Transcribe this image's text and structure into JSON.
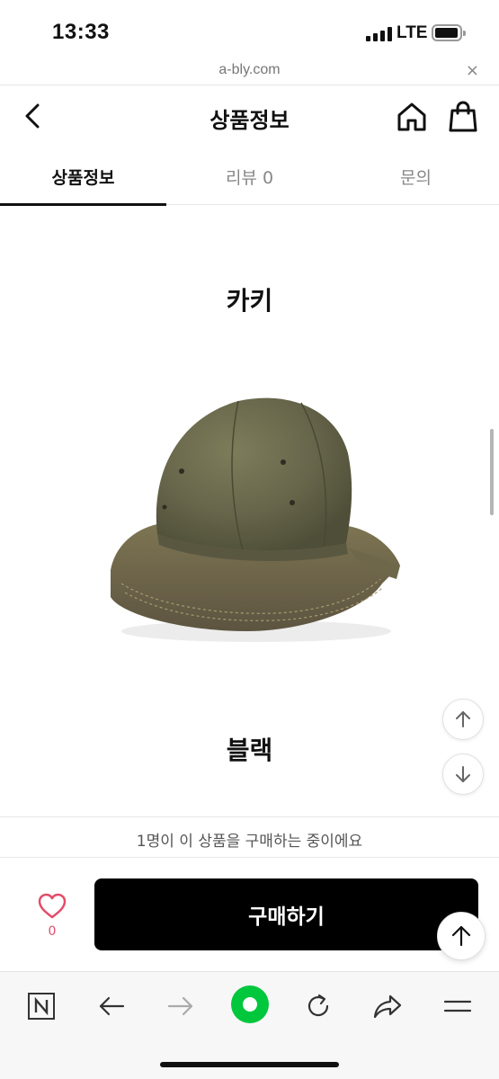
{
  "status_bar": {
    "time": "13:33",
    "network": "LTE"
  },
  "url_bar": {
    "url": "a-bly.com",
    "close_label": "×"
  },
  "header": {
    "title": "상품정보",
    "icons": [
      "back-icon",
      "home-icon",
      "bag-icon"
    ]
  },
  "tabs": [
    {
      "label": "상품정보",
      "active": true
    },
    {
      "label": "리뷰 0",
      "active": false
    },
    {
      "label": "문의",
      "active": false
    }
  ],
  "content": {
    "color_labels": [
      "카키",
      "블랙"
    ],
    "product_image": "khaki-bucket-hat"
  },
  "buy_info": {
    "text": "1명이 이 상품을 구매하는 중이에요"
  },
  "buy_bar": {
    "like_count": "0",
    "buy_label": "구매하기"
  },
  "browser_toolbar": {
    "icons": [
      "naver-icon",
      "back-arrow-icon",
      "forward-arrow-icon",
      "green-dot-icon",
      "reload-icon",
      "share-icon",
      "menu-icon"
    ]
  },
  "colors": {
    "accent_green": "#00c73c",
    "heart_pink": "#e34d6b",
    "buy_button": "#000000"
  }
}
